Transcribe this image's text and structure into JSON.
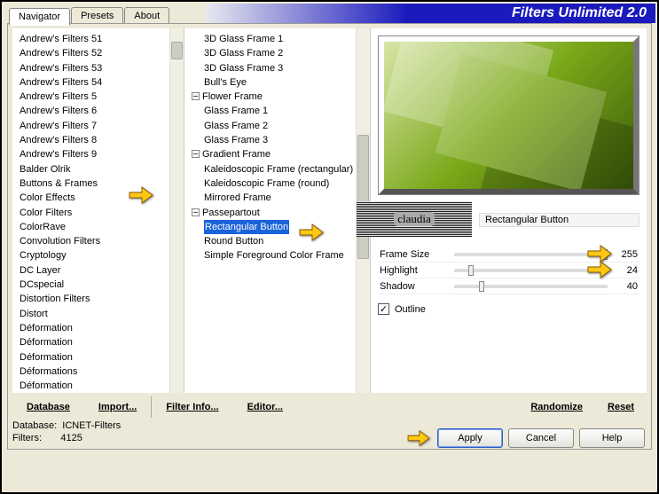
{
  "header": {
    "title": "Filters Unlimited 2.0"
  },
  "tabs": [
    "Navigator",
    "Presets",
    "About"
  ],
  "categories": [
    "Andrew's Filters 51",
    "Andrew's Filters 52",
    "Andrew's Filters 53",
    "Andrew's Filters 54",
    "Andrew's Filters 5",
    "Andrew's Filters 6",
    "Andrew's Filters 7",
    "Andrew's Filters 8",
    "Andrew's Filters 9",
    "Balder Olrik",
    "Buttons & Frames",
    "Color Effects",
    "Color Filters",
    "ColorRave",
    "Convolution Filters",
    "Cryptology",
    "DC Layer",
    "DCspecial",
    "Distortion Filters",
    "Distort",
    "Déformation",
    "Déformation",
    "Déformation",
    "Déformations",
    "Déformation"
  ],
  "categories_selected_index": 10,
  "filters": [
    {
      "label": "3D Glass Frame 1",
      "group": false
    },
    {
      "label": "3D Glass Frame 2",
      "group": false
    },
    {
      "label": "3D Glass Frame 3",
      "group": false
    },
    {
      "label": "Bull's Eye",
      "group": false
    },
    {
      "label": "Flower Frame",
      "group": true
    },
    {
      "label": "Glass Frame 1",
      "group": false
    },
    {
      "label": "Glass Frame 2",
      "group": false
    },
    {
      "label": "Glass Frame 3",
      "group": false
    },
    {
      "label": "Gradient Frame",
      "group": true
    },
    {
      "label": "Kaleidoscopic Frame (rectangular)",
      "group": false
    },
    {
      "label": "Kaleidoscopic Frame (round)",
      "group": false
    },
    {
      "label": "Mirrored Frame",
      "group": false
    },
    {
      "label": "Passepartout",
      "group": true
    },
    {
      "label": "Rectangular Button",
      "group": false,
      "selected": true
    },
    {
      "label": "Round Button",
      "group": false
    },
    {
      "label": "Simple Foreground Color Frame",
      "group": false
    }
  ],
  "preview": {
    "filter_name": "Rectangular Button",
    "watermark": "claudia"
  },
  "params": [
    {
      "label": "Frame Size",
      "value": "255"
    },
    {
      "label": "Highlight",
      "value": "24"
    },
    {
      "label": "Shadow",
      "value": "40"
    }
  ],
  "options": {
    "outline_label": "Outline",
    "outline_checked": true
  },
  "toolbar": {
    "database": "Database",
    "import": "Import...",
    "filter_info": "Filter Info...",
    "editor": "Editor...",
    "randomize": "Randomize",
    "reset": "Reset"
  },
  "status": {
    "db_label": "Database:",
    "db_value": "ICNET-Filters",
    "filters_label": "Filters:",
    "filters_value": "4125"
  },
  "buttons": {
    "apply": "Apply",
    "cancel": "Cancel",
    "help": "Help"
  }
}
